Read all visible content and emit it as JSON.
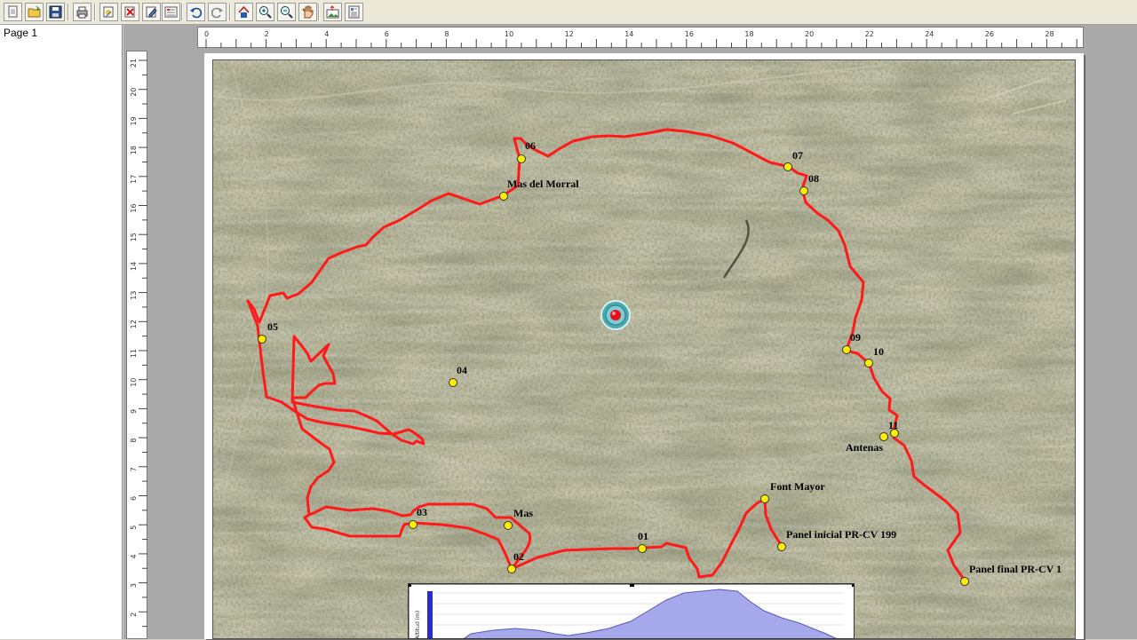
{
  "toolbar": {
    "buttons": [
      {
        "name": "new-document-button",
        "icon": "new-document-icon"
      },
      {
        "name": "open-button",
        "icon": "open-folder-icon"
      },
      {
        "name": "save-button",
        "icon": "floppy-icon"
      },
      {
        "name": "print-setup-button",
        "icon": "printer-icon"
      },
      {
        "name": "insert-object-button",
        "icon": "insert-object-icon"
      },
      {
        "name": "delete-object-button",
        "icon": "delete-icon"
      },
      {
        "name": "edit-object-button",
        "icon": "edit-icon"
      },
      {
        "name": "properties-button",
        "icon": "properties-icon"
      },
      {
        "name": "undo-button",
        "icon": "undo-icon"
      },
      {
        "name": "redo-button",
        "icon": "redo-icon"
      },
      {
        "name": "home-view-button",
        "icon": "home-icon"
      },
      {
        "name": "zoom-in-button",
        "icon": "zoom-in-icon"
      },
      {
        "name": "zoom-out-button",
        "icon": "zoom-out-icon"
      },
      {
        "name": "pan-button",
        "icon": "hand-icon"
      },
      {
        "name": "export-image-button",
        "icon": "export-image-icon"
      },
      {
        "name": "page-layout-button",
        "icon": "page-layout-icon"
      }
    ]
  },
  "pages_panel": {
    "pages": [
      "Page 1"
    ]
  },
  "rulers": {
    "horizontal_labels": [
      "0",
      "2",
      "4",
      "6",
      "8",
      "10",
      "12",
      "14",
      "16",
      "18",
      "20",
      "22",
      "24",
      "26",
      "28"
    ],
    "vertical_labels": [
      "21",
      "20",
      "19",
      "18",
      "17",
      "16",
      "15",
      "14",
      "13",
      "12",
      "11",
      "10",
      "9",
      "8",
      "7",
      "6",
      "5",
      "4",
      "3",
      "2",
      "1"
    ]
  },
  "map": {
    "route_color": "#ff1a1a",
    "waypoint_color": "#ffee00",
    "waypoints": {
      "wp01": "01",
      "wp02": "02",
      "wp03": "03",
      "wp04": "04",
      "wp05": "05",
      "wp06": "06",
      "wp07": "07",
      "wp08": "08",
      "wp09": "09",
      "wp10": "10",
      "wp11": "11",
      "mas_del_morral": "Mas del Morral",
      "mas": "Mas",
      "font_mayor": "Font Mayor",
      "panel_inicial": "Panel inicial PR-CV 199",
      "panel_final": "Panel final PR-CV 1",
      "antenas": "Antenas"
    }
  },
  "profile": {
    "fill_color": "#a6a8ec",
    "axis_label": "Altitud (m)"
  }
}
